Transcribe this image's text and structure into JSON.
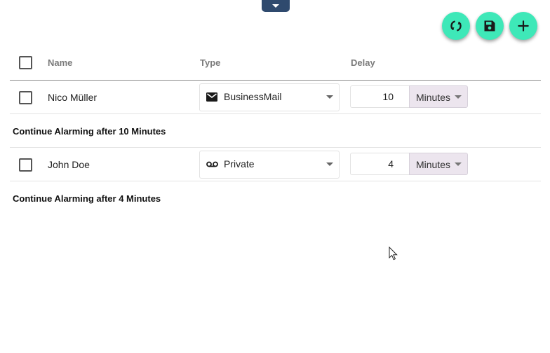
{
  "toolbar": {
    "refresh_icon": "refresh-icon",
    "save_icon": "save-icon",
    "add_icon": "plus-icon",
    "fab_color": "#3ee8b8",
    "collapse_icon": "chevron-down-icon"
  },
  "table": {
    "columns": {
      "name": "Name",
      "type": "Type",
      "delay": "Delay"
    },
    "rows": [
      {
        "name": "Nico Müller",
        "type": "BusinessMail",
        "type_icon": "mail-icon",
        "delay": "10",
        "unit": "Minutes",
        "info": "Continue Alarming after 10 Minutes"
      },
      {
        "name": "John Doe",
        "type": "Private",
        "type_icon": "voicemail-icon",
        "delay": "4",
        "unit": "Minutes",
        "info": "Continue Alarming after 4 Minutes"
      }
    ]
  }
}
